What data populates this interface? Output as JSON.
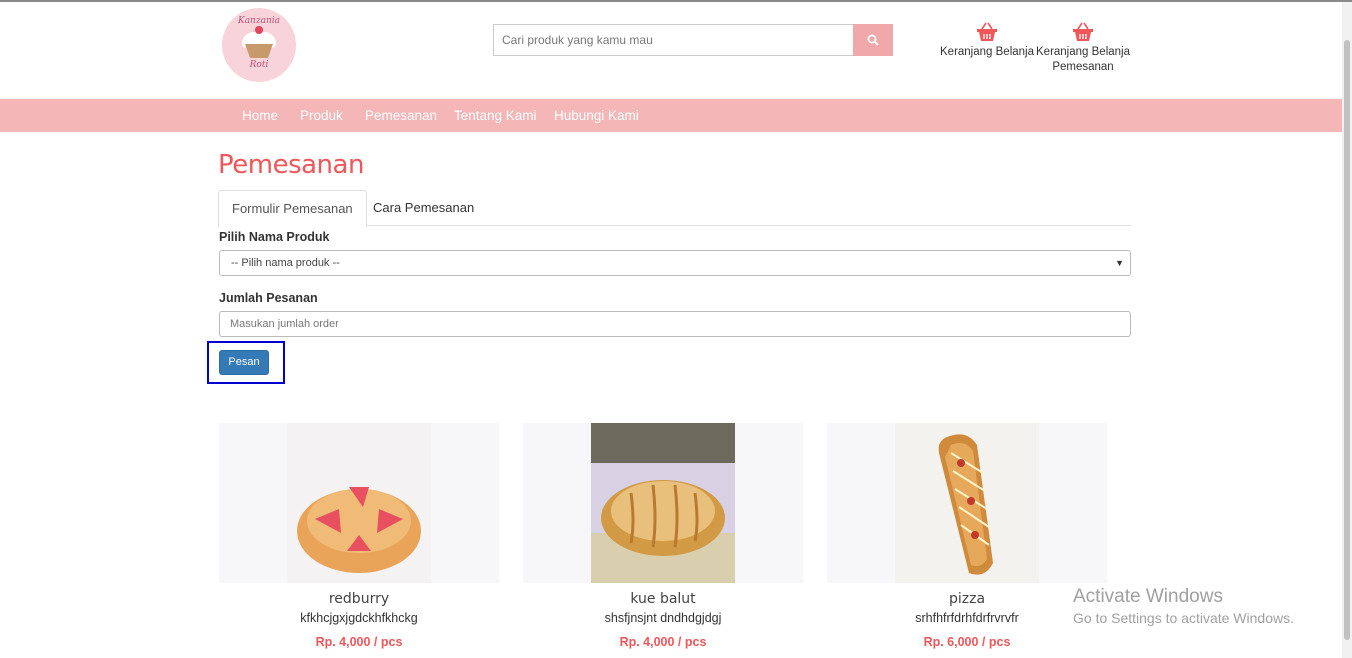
{
  "header": {
    "logo_text_top": "Kanzania",
    "logo_text_bottom": "Roti",
    "search_placeholder": "Cari produk yang kamu mau",
    "cart_label": "Keranjang Belanja",
    "order_cart_label_line1": "Keranjang Belanja",
    "order_cart_label_line2": "Pemesanan",
    "search_icon": "search-icon",
    "cart_icon": "basket-icon"
  },
  "nav": {
    "items": [
      "Home",
      "Produk",
      "Pemesanan",
      "Tentang Kami",
      "Hubungi Kami"
    ]
  },
  "main": {
    "title": "Pemesanan",
    "tabs": [
      "Formulir Pemesanan",
      "Cara Pemesanan"
    ],
    "product_label": "Pilih Nama Produk",
    "product_select_value": "-- Pilih nama produk --",
    "quantity_label": "Jumlah Pesanan",
    "quantity_placeholder": "Masukan jumlah order",
    "submit_label": "Pesan"
  },
  "products": [
    {
      "name": "redburry",
      "desc": "kfkhcjgxjgdckhfkhckg",
      "price": "Rp. 4,000 / pcs"
    },
    {
      "name": "kue balut",
      "desc": "shsfjnsjnt dndhdgjdgj",
      "price": "Rp. 4,000 / pcs"
    },
    {
      "name": "pizza",
      "desc": "srhfhfrfdrhfdrfrvrvfr",
      "price": "Rp. 6,000 / pcs"
    }
  ],
  "watermark": {
    "line1": "Activate Windows",
    "line2": "Go to Settings to activate Windows."
  },
  "colors": {
    "accent": "#f0575a",
    "nav_bg": "#f4b6b7",
    "button": "#337ab7",
    "search_btn": "#f0a8aa"
  }
}
